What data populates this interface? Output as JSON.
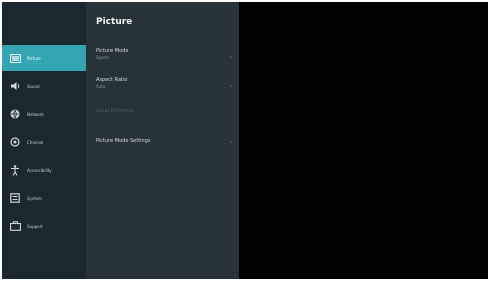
{
  "sidebar": {
    "items": [
      {
        "label": "Picture",
        "icon": "picture-icon"
      },
      {
        "label": "Sound",
        "icon": "sound-icon"
      },
      {
        "label": "Network",
        "icon": "network-icon"
      },
      {
        "label": "Channel",
        "icon": "channel-icon"
      },
      {
        "label": "Accessibility",
        "icon": "accessibility-icon"
      },
      {
        "label": "System",
        "icon": "system-icon"
      },
      {
        "label": "Support",
        "icon": "support-icon"
      }
    ]
  },
  "panel": {
    "title": "Picture",
    "rows": [
      {
        "label": "Picture Mode",
        "value": "Sports"
      },
      {
        "label": "Aspect Ratio",
        "value": "Auto"
      },
      {
        "label": "Local Dimming",
        "value": ""
      },
      {
        "label": "Picture Mode Settings",
        "value": ""
      }
    ]
  },
  "colors": {
    "sidebar_bg": "#1a2830",
    "panel_bg": "#263339",
    "accent": "#33a6b2",
    "screen_bg": "#000000"
  }
}
